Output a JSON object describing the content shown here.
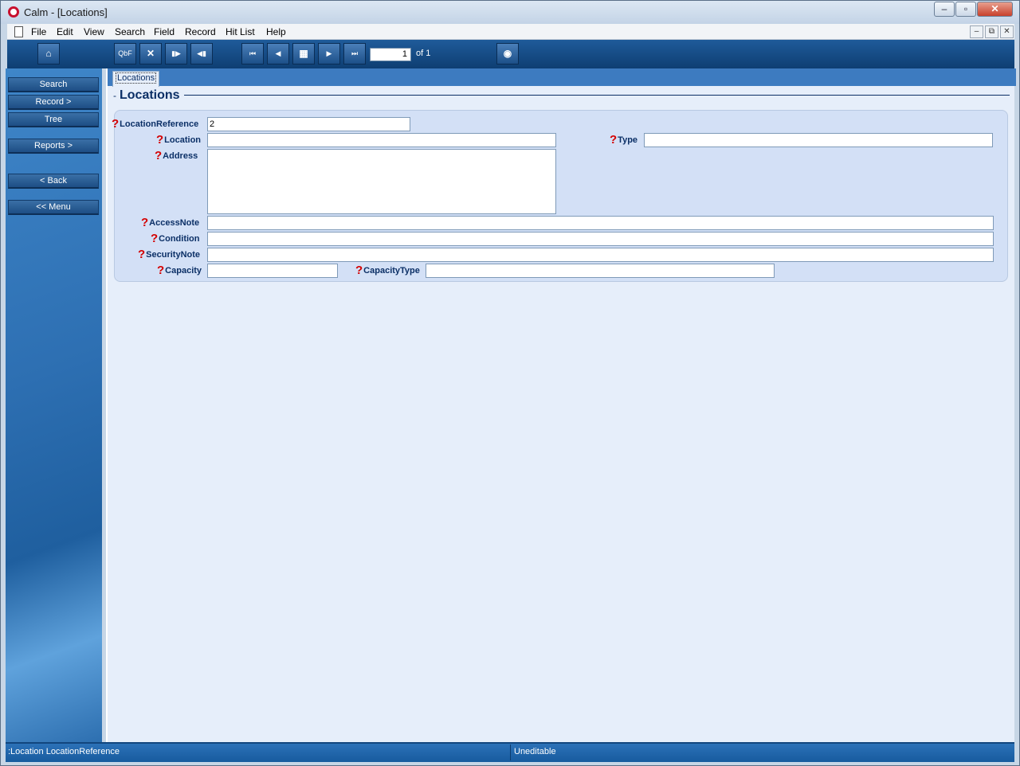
{
  "window": {
    "title": "Calm - [Locations]",
    "buttons": {
      "minimize": "–",
      "maximize": "▫",
      "close": "✕"
    }
  },
  "menubar": {
    "items": [
      "File",
      "Edit",
      "View",
      "Search",
      "Field",
      "Record",
      "Hit List",
      "Help"
    ],
    "mdi": {
      "minimize": "–",
      "restore": "⧉",
      "close": "✕"
    }
  },
  "toolbar": {
    "home_icon": "⌂",
    "qbf_label": "QbF",
    "expand_icon": "✕",
    "forward_icon": "▮▶",
    "back_icon": "◀▮",
    "first_icon": "⏮",
    "prev_icon": "◀",
    "list_icon": "▦",
    "next_icon": "▶",
    "last_icon": "⏭",
    "record_number": "1",
    "record_of": "of 1",
    "eye_icon": "◉"
  },
  "sidebar": {
    "search": "Search",
    "record": "Record >",
    "tree": "Tree",
    "reports": "Reports >",
    "back": "< Back",
    "menu": "<< Menu"
  },
  "tab": {
    "label": "Locations"
  },
  "section": {
    "dash": "-",
    "title": "Locations"
  },
  "fields": {
    "location_reference": {
      "label": "LocationReference",
      "value": "2"
    },
    "location": {
      "label": "Location",
      "value": ""
    },
    "type": {
      "label": "Type",
      "value": ""
    },
    "address": {
      "label": "Address",
      "value": ""
    },
    "access_note": {
      "label": "AccessNote",
      "value": ""
    },
    "condition": {
      "label": "Condition",
      "value": ""
    },
    "security_note": {
      "label": "SecurityNote",
      "value": ""
    },
    "capacity": {
      "label": "Capacity",
      "value": ""
    },
    "capacity_type": {
      "label": "CapacityType",
      "value": ""
    },
    "help_icon": "?"
  },
  "statusbar": {
    "left": ":Location LocationReference",
    "right": "Uneditable"
  }
}
